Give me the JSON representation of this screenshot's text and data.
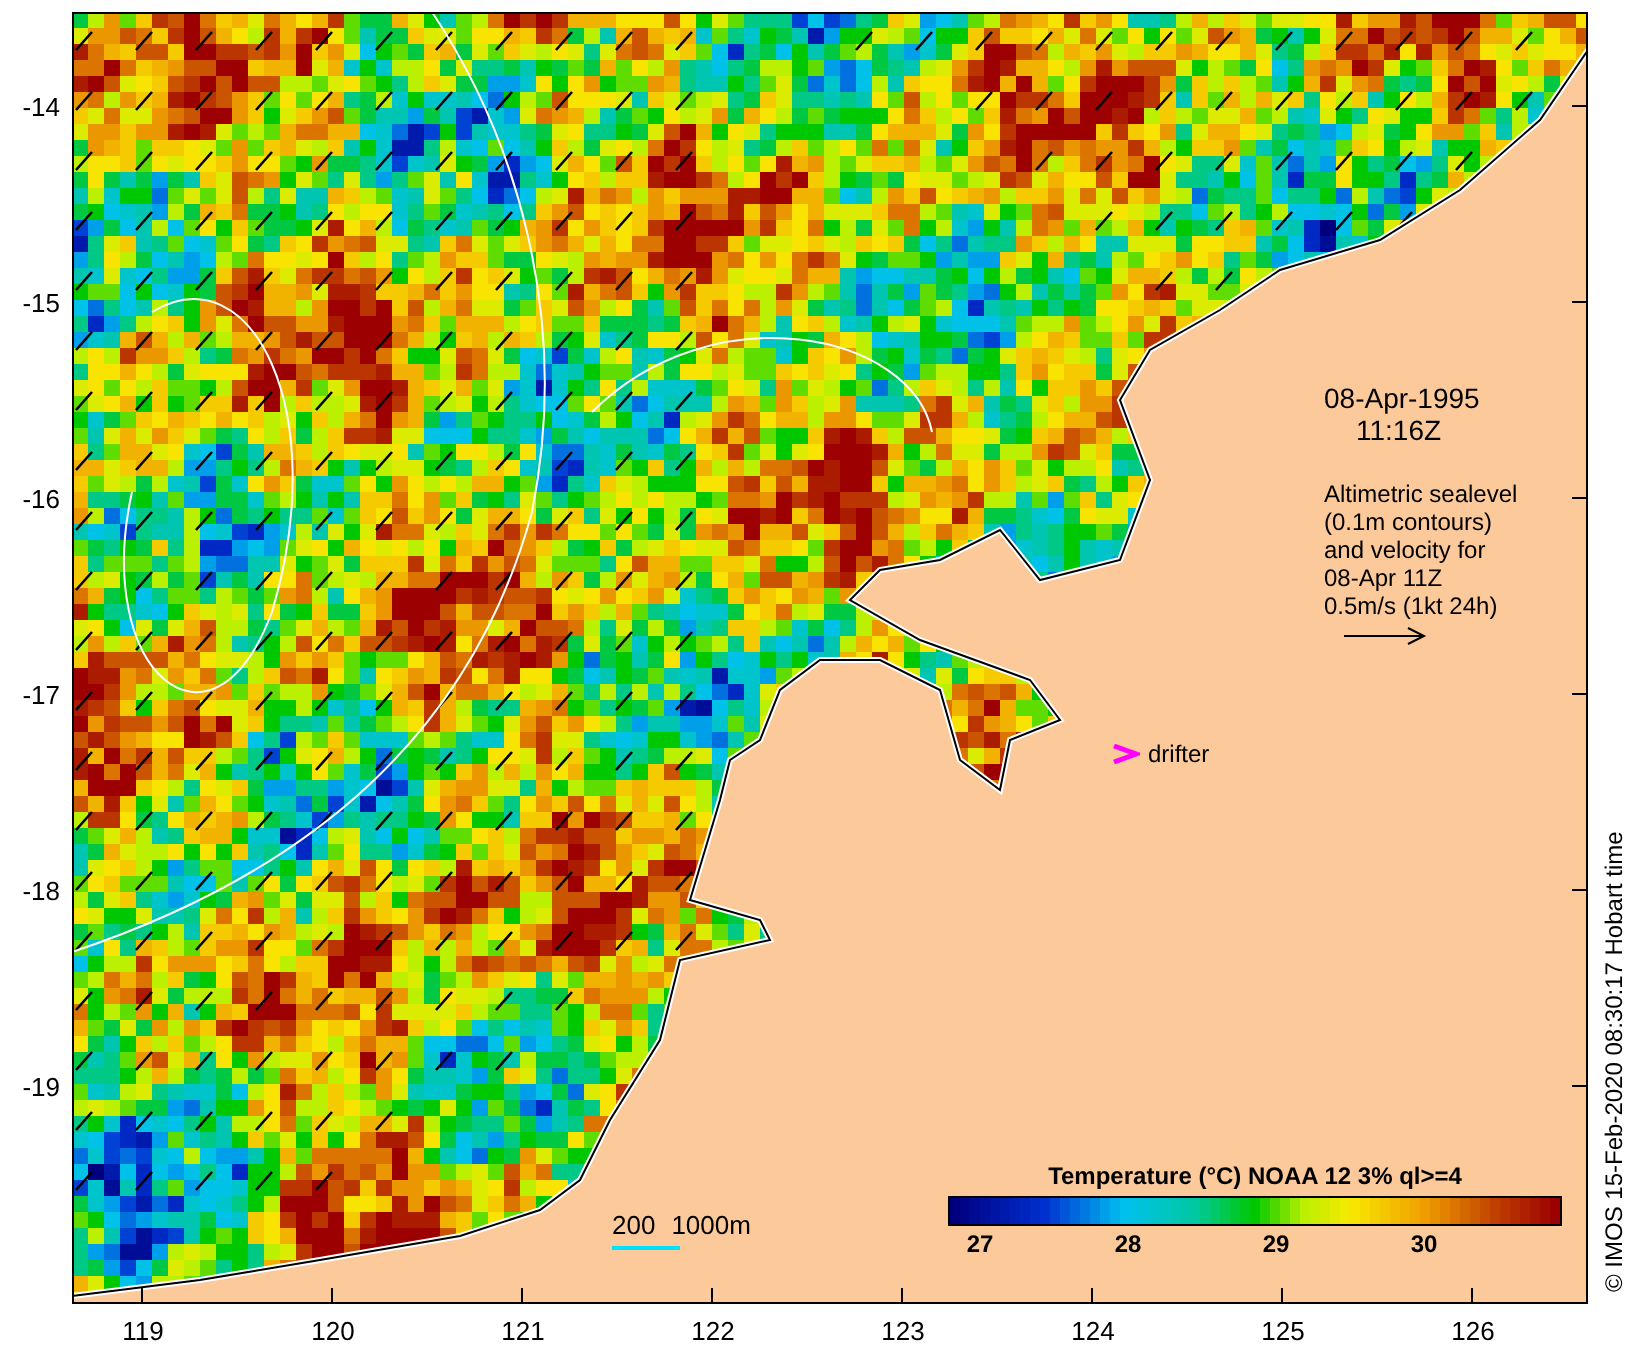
{
  "map": {
    "y_axis_labels": [
      "-14",
      "-15",
      "-16",
      "-17",
      "-18",
      "-19"
    ],
    "x_axis_labels": [
      "119",
      "120",
      "121",
      "122",
      "123",
      "124",
      "125",
      "126"
    ],
    "date": "08-Apr-1995",
    "time": "11:16Z",
    "note_lines": [
      "Altimetric sealevel",
      "(0.1m contours)",
      "and velocity for",
      "08-Apr 11Z",
      "0.5m/s (1kt 24h)"
    ],
    "drifter_label": "drifter",
    "depth_labels": [
      "200",
      "1000m"
    ],
    "colorbar": {
      "title": "Temperature (°C) NOAA 12 3% ql>=4",
      "tick_labels": [
        "27",
        "28",
        "29",
        "30"
      ]
    }
  },
  "credit": "© IMOS 15-Feb-2020 08:30:17 Hobart time"
}
